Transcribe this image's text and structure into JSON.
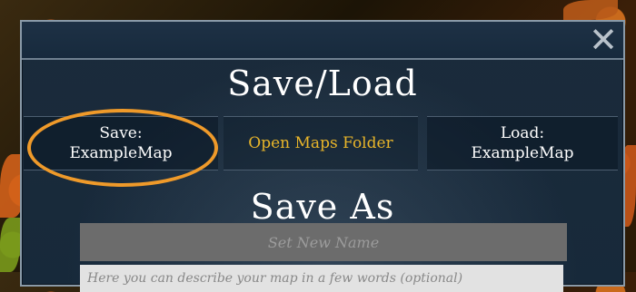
{
  "window": {
    "close_icon": "close-icon",
    "title": "Save/Load"
  },
  "actions": {
    "save_label": "Save:\nExampleMap",
    "open_folder_label": "Open Maps Folder",
    "load_label": "Load:\nExampleMap"
  },
  "save_as": {
    "heading": "Save As",
    "name_placeholder": "Set New Name",
    "description_placeholder": "Here you can describe your map in a few words (optional)"
  },
  "colors": {
    "accent_highlight": "#ef9a2a",
    "folder_link": "#e8b52a",
    "panel_bg": "#17293a"
  }
}
